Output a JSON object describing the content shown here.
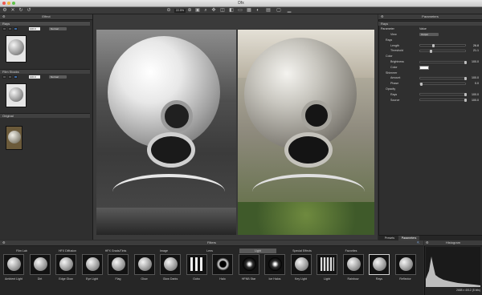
{
  "window": {
    "title": "Dfx"
  },
  "left_panel": {
    "header": "Effect",
    "rays": {
      "title": "Rays",
      "value": "100.0",
      "mode": "Normal"
    },
    "film_stocks": {
      "title": "Film Stocks",
      "value": "100.0",
      "mode": "Normal"
    },
    "original": {
      "title": "Original"
    }
  },
  "viewer": {
    "zoom": "22.5%"
  },
  "params": {
    "header": "Parameters",
    "section": "Rays",
    "col_param": "Parameter",
    "col_value": "Value",
    "rows": [
      {
        "label": "View",
        "kind": "dropdown",
        "value": "Output"
      },
      {
        "label": "Rays",
        "kind": "label"
      },
      {
        "label": "Length",
        "kind": "slider",
        "value": "26.8",
        "pos": 0.27
      },
      {
        "label": "Threshold",
        "kind": "slider",
        "value": "21.1",
        "pos": 0.21
      },
      {
        "label": "Color",
        "kind": "label"
      },
      {
        "label": "Brightness",
        "kind": "slider",
        "value": "100.0",
        "pos": 1.0
      },
      {
        "label": "Color",
        "kind": "swatch",
        "color": "#ffffff"
      },
      {
        "label": "Shimmer",
        "kind": "label"
      },
      {
        "label": "Amount",
        "kind": "slider",
        "value": "100.0",
        "pos": 1.0
      },
      {
        "label": "Phase",
        "kind": "slider",
        "value": "0.0",
        "pos": 0.0
      },
      {
        "label": "Opacity",
        "kind": "label"
      },
      {
        "label": "Rays",
        "kind": "slider",
        "value": "100.0",
        "pos": 1.0
      },
      {
        "label": "Source",
        "kind": "slider",
        "value": "100.0",
        "pos": 1.0
      }
    ],
    "tabs": [
      "Presets",
      "Parameters"
    ]
  },
  "filters": {
    "header": "Filters",
    "categories": [
      "Film Lab",
      "HFX Diffusion",
      "HFX Grads/Tints",
      "Image",
      "Lens",
      "Light",
      "Special Effects",
      "Favorites"
    ],
    "items": [
      "Ambient Light",
      "Dirt",
      "Edge Glow",
      "Eye Light",
      "Flag",
      "Glow",
      "Glow Darks",
      "Gobo",
      "Halo",
      "HFNB Star",
      "Ice Halos",
      "Key Light",
      "Light",
      "Rainbow",
      "Rays",
      "Reflector"
    ]
  },
  "histogram": {
    "header": "Histogram",
    "info": "2688 x 4012 (8 bits)"
  },
  "colors": {
    "accent": "#3d6da8",
    "selected_cat": "#5a5a5a"
  }
}
